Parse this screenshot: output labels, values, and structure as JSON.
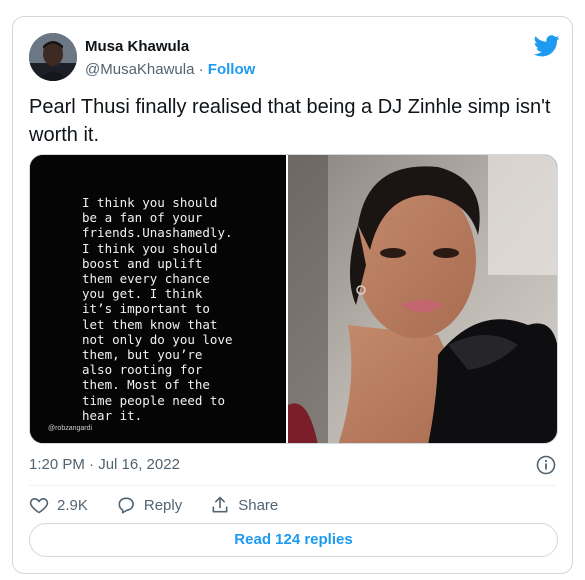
{
  "author": {
    "display_name": "Musa Khawula",
    "handle": "@MusaKhawula",
    "separator": "·",
    "follow_label": "Follow"
  },
  "tweet": {
    "text": "Pearl Thusi finally realised that being a DJ Zinhle simp isn't worth it.",
    "timestamp": "1:20 PM · Jul 16, 2022"
  },
  "media": {
    "quote_text": "I think you should\nbe a fan of your\nfriends.Unashamedly.\nI think you should\nboost and uplift\nthem every chance\nyou get. I think\nit’s important to\nlet them know that\nnot only do you love\nthem, but you’re\nalso rooting for\nthem. Most of the\ntime people need to\nhear it.",
    "watermark": "@robzangardi"
  },
  "actions": {
    "likes": "2.9K",
    "reply_label": "Reply",
    "share_label": "Share"
  },
  "read_replies_label": "Read 124 replies",
  "colors": {
    "accent": "#1d9bf0",
    "secondary_text": "#536471",
    "border": "#cfd9de"
  },
  "icons": [
    "twitter-bird-icon",
    "info-icon",
    "heart-icon",
    "reply-icon",
    "share-icon"
  ]
}
